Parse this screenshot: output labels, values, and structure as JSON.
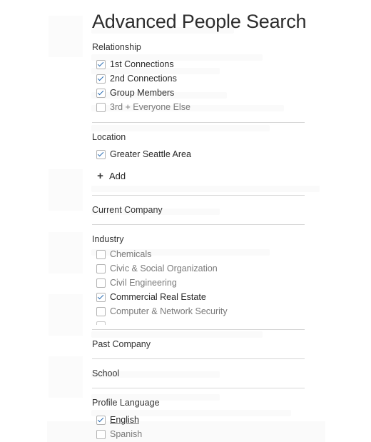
{
  "title": "Advanced People Search",
  "sections": {
    "relationship": {
      "title": "Relationship",
      "options": [
        {
          "label": "1st Connections",
          "checked": true
        },
        {
          "label": "2nd Connections",
          "checked": true
        },
        {
          "label": "Group Members",
          "checked": true
        },
        {
          "label": "3rd + Everyone Else",
          "checked": false
        }
      ]
    },
    "location": {
      "title": "Location",
      "options": [
        {
          "label": "Greater Seattle Area",
          "checked": true
        }
      ],
      "add_label": "Add"
    },
    "current_company": {
      "title": "Current Company"
    },
    "industry": {
      "title": "Industry",
      "options": [
        {
          "label": "Chemicals",
          "checked": false
        },
        {
          "label": "Civic & Social Organization",
          "checked": false
        },
        {
          "label": "Civil Engineering",
          "checked": false
        },
        {
          "label": "Commercial Real Estate",
          "checked": true
        },
        {
          "label": "Computer & Network Security",
          "checked": false
        }
      ]
    },
    "past_company": {
      "title": "Past Company"
    },
    "school": {
      "title": "School"
    },
    "profile_language": {
      "title": "Profile Language",
      "options": [
        {
          "label": "English",
          "checked": true
        },
        {
          "label": "Spanish",
          "checked": false
        }
      ]
    }
  },
  "colors": {
    "check": "#2a6db3",
    "text": "#2a2a2a",
    "muted": "#7a7a7a",
    "divider": "#d6d6d6"
  }
}
